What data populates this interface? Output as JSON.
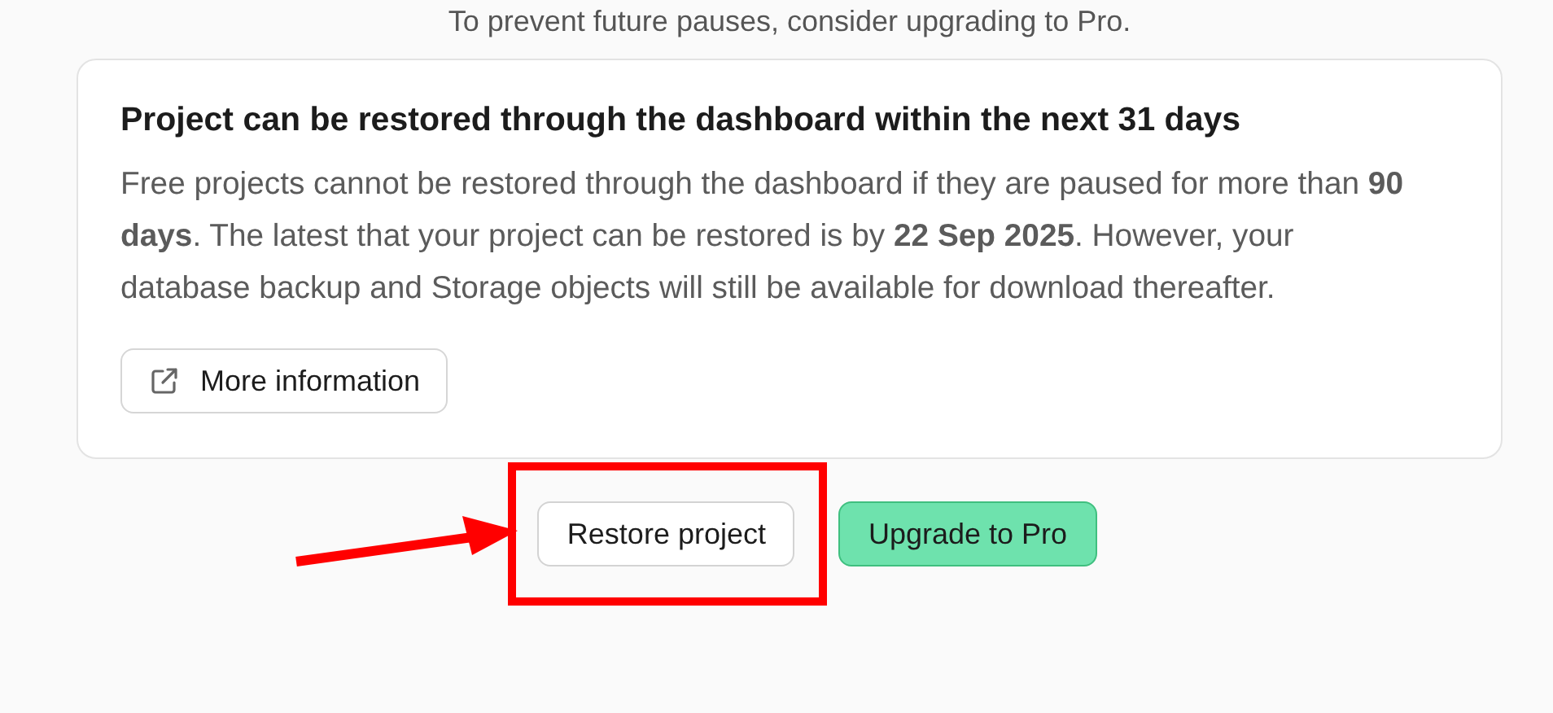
{
  "notice": "To prevent future pauses, consider upgrading to Pro.",
  "card": {
    "title": "Project can be restored through the dashboard within the next 31 days",
    "body": "Free projects cannot be restored through the dashboard if they are paused for more than **90 days**. The latest that your project can be restored is by **22 Sep 2025**. However, your database backup and Storage objects will still be available for download thereafter.",
    "link_button": "More information"
  },
  "actions": [
    {
      "label": "Restore project",
      "kind": "secondary",
      "highlighted": true
    },
    {
      "label": "Upgrade to Pro",
      "kind": "primary",
      "highlighted": false
    }
  ]
}
